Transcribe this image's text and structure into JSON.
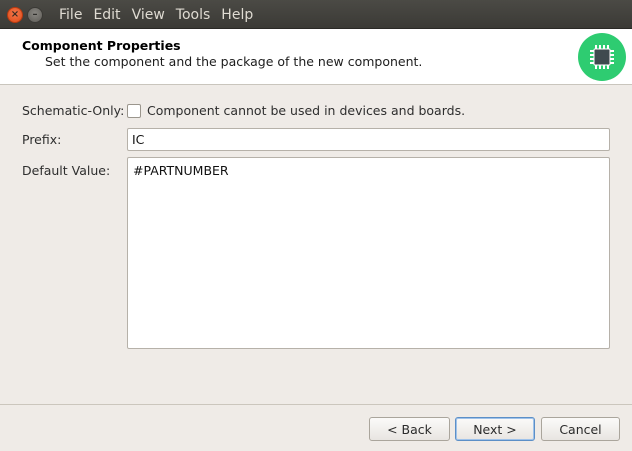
{
  "menubar": {
    "items": [
      "File",
      "Edit",
      "View",
      "Tools",
      "Help"
    ]
  },
  "header": {
    "title": "Component Properties",
    "subtitle": "Set the component and the package of the new component.",
    "icon": "chip-icon",
    "icon_color": "#2ecc71"
  },
  "form": {
    "schematic_only": {
      "label": "Schematic-Only:",
      "checkbox_text": "Component cannot be used in devices and boards.",
      "checked": false
    },
    "prefix": {
      "label": "Prefix:",
      "value": "IC"
    },
    "default_value": {
      "label": "Default Value:",
      "value": "#PARTNUMBER"
    }
  },
  "buttons": {
    "back": "< Back",
    "next": "Next >",
    "cancel": "Cancel"
  }
}
